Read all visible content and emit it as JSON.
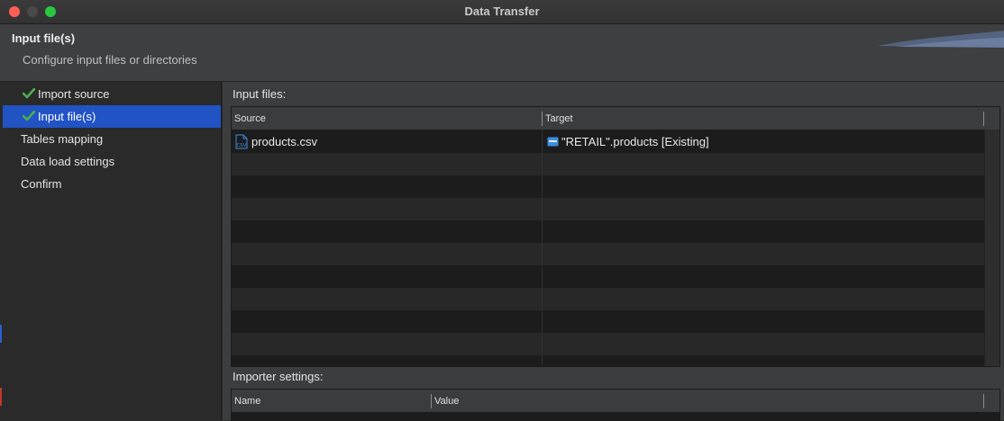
{
  "window": {
    "title": "Data Transfer"
  },
  "header": {
    "title": "Input file(s)",
    "subtitle": "Configure input files or directories"
  },
  "sidebar": {
    "items": [
      {
        "label": "Import source",
        "completed": true,
        "active": false
      },
      {
        "label": "Input file(s)",
        "completed": true,
        "active": true
      },
      {
        "label": "Tables mapping",
        "completed": false,
        "active": false
      },
      {
        "label": "Data load settings",
        "completed": false,
        "active": false
      },
      {
        "label": "Confirm",
        "completed": false,
        "active": false
      }
    ]
  },
  "input_files": {
    "label": "Input files:",
    "columns": [
      "Source",
      "Target"
    ],
    "rows": [
      {
        "source": "products.csv",
        "source_icon": "csv-file-icon",
        "target": "\"RETAIL\".products [Existing]",
        "target_icon": "table-icon"
      }
    ]
  },
  "importer_settings": {
    "label": "Importer settings:",
    "columns": [
      "Name",
      "Value"
    ]
  },
  "colors": {
    "accent": "#2153c5",
    "check": "#4caf50",
    "icon_blue": "#3c8dde"
  }
}
